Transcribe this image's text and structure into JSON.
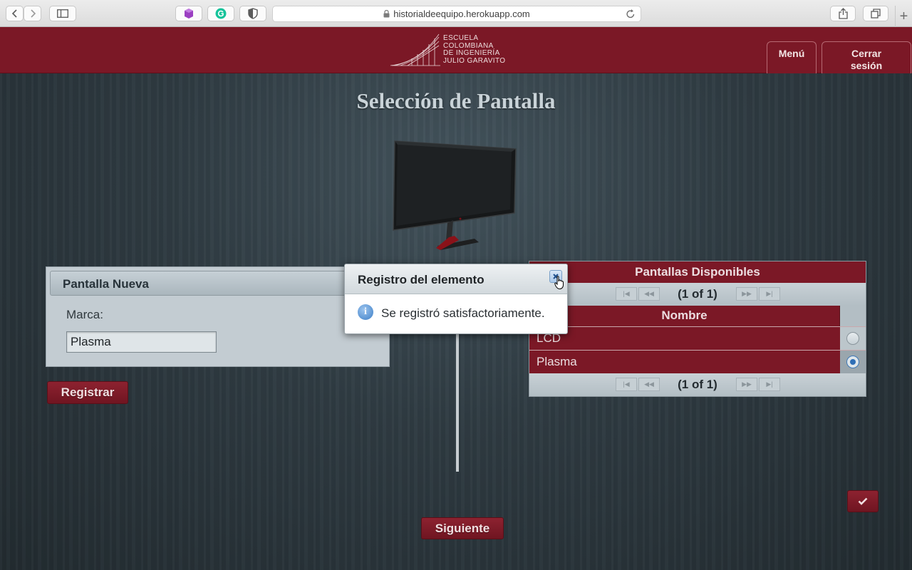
{
  "browser": {
    "url": "historialdeequipo.herokuapp.com",
    "new_tab": "+"
  },
  "header": {
    "logo_lines": [
      "Escuela",
      "Colombiana",
      "de Ingeniería",
      "Julio Garavito"
    ],
    "menu_label": "Menú",
    "logout_line1": "Cerrar",
    "logout_line2": "sesión"
  },
  "page": {
    "title": "Selección de Pantalla"
  },
  "new_screen": {
    "title": "Pantalla Nueva",
    "brand_label": "Marca:",
    "brand_value": "Plasma",
    "register_label": "Registrar"
  },
  "available": {
    "title": "Pantallas Disponibles",
    "page_report": "(1 of 1)",
    "column_name": "Nombre",
    "rows": [
      {
        "name": "LCD",
        "selected": false
      },
      {
        "name": "Plasma",
        "selected": true
      }
    ]
  },
  "dialog": {
    "title": "Registro del elemento",
    "message": "Se registró satisfactoriamente."
  },
  "footer": {
    "next_label": "Siguiente"
  },
  "icons": {
    "back": "chevron-left-icon",
    "forward": "chevron-right-icon",
    "sidebar": "sidebar-icon",
    "confirm": "check-icon",
    "info": "info-icon"
  },
  "colors": {
    "brand": "#7b1826",
    "panel": "#c3ccd2",
    "accent": "#2f6fb6"
  }
}
